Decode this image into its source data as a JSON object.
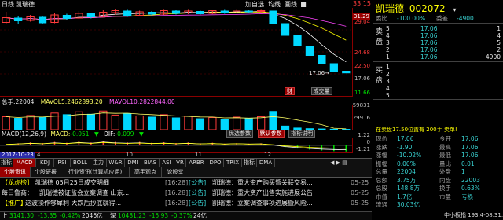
{
  "topbar": {
    "period": "日线",
    "name": "凯瑞德",
    "menu": [
      "加自选",
      "均线",
      "画线"
    ],
    "price_high": "33.15",
    "price_cur": "31.29"
  },
  "price_axis": [
    "29.04",
    "24.68",
    "22.50",
    "17.06",
    "11.66"
  ],
  "price_axis_colors": [
    "#ff3b3b",
    "#ff3b3b",
    "#ff3b3b",
    "#c0c0c0",
    "#00e000"
  ],
  "candles": [
    {
      "o": 29.9,
      "c": 31.1,
      "h": 32.6,
      "l": 29.4
    },
    {
      "o": 31.0,
      "c": 30.3,
      "h": 31.6,
      "l": 29.6
    },
    {
      "o": 30.4,
      "c": 31.3,
      "h": 31.8,
      "l": 30.1
    },
    {
      "o": 31.2,
      "c": 29.8,
      "h": 31.5,
      "l": 29.6
    },
    {
      "o": 29.9,
      "c": 31.8,
      "h": 32.4,
      "l": 29.7
    },
    {
      "o": 31.7,
      "c": 30.9,
      "h": 32.1,
      "l": 30.6
    },
    {
      "o": 31.0,
      "c": 32.2,
      "h": 32.8,
      "l": 30.8
    },
    {
      "o": 32.1,
      "c": 31.3,
      "h": 32.4,
      "l": 30.9
    },
    {
      "o": 31.4,
      "c": 32.5,
      "h": 33.0,
      "l": 31.2
    },
    {
      "o": 32.4,
      "c": 32.9,
      "h": 33.2,
      "l": 31.9
    },
    {
      "o": 32.8,
      "c": 31.6,
      "h": 33.1,
      "l": 31.3
    },
    {
      "o": 31.7,
      "c": 32.6,
      "h": 32.9,
      "l": 31.4
    },
    {
      "o": 32.5,
      "c": 32.0,
      "h": 32.8,
      "l": 31.6
    },
    {
      "o": 32.0,
      "c": 32.9,
      "h": 33.1,
      "l": 31.8
    },
    {
      "o": 32.8,
      "c": 32.2,
      "h": 33.0,
      "l": 31.9
    },
    {
      "o": 32.3,
      "c": 32.8,
      "h": 33.1,
      "l": 32.0
    },
    {
      "o": 32.7,
      "c": 32.1,
      "h": 32.9,
      "l": 31.9
    },
    {
      "o": 32.2,
      "c": 32.9,
      "h": 33.0,
      "l": 32.0
    },
    {
      "o": 32.8,
      "c": 32.4,
      "h": 33.1,
      "l": 32.1
    },
    {
      "o": 32.3,
      "c": 32.8,
      "h": 33.1,
      "l": 32.2
    },
    {
      "o": 32.8,
      "c": 32.6,
      "h": 33.0,
      "l": 32.3
    },
    {
      "o": 32.7,
      "c": 32.9,
      "h": 33.1,
      "l": 32.4
    },
    {
      "o": 32.8,
      "c": 29.6,
      "h": 32.9,
      "l": 29.4
    },
    {
      "o": 29.6,
      "c": 26.6,
      "h": 29.6,
      "l": 26.6
    },
    {
      "o": 26.6,
      "c": 23.9,
      "h": 26.6,
      "l": 23.9
    },
    {
      "o": 23.9,
      "c": 21.5,
      "h": 23.9,
      "l": 21.5
    },
    {
      "o": 21.5,
      "c": 19.4,
      "h": 21.5,
      "l": 19.4
    },
    {
      "o": 19.4,
      "c": 17.5,
      "h": 19.4,
      "l": 17.5
    },
    {
      "o": 17.5,
      "c": 17.06,
      "h": 17.5,
      "l": 17.06
    }
  ],
  "price_range": [
    11.2,
    33.6
  ],
  "price_labels": {
    "low_tag": "17.06",
    "low_sym": "→"
  },
  "kchart_buttons": {
    "xiao": "财",
    "big": "成交量"
  },
  "volume_legend": {
    "total_label": "总手:",
    "total": "22004",
    "mavol5_label": "MAVOL5:",
    "mavol5": "2462893.20",
    "mavol10_label": "MAVOL10:",
    "mavol10": "2822844.00"
  },
  "volume_axis": [
    "59831",
    "29916"
  ],
  "volume_bars": [
    {
      "v": 32000,
      "up": true
    },
    {
      "v": 28000,
      "up": false
    },
    {
      "v": 35000,
      "up": true
    },
    {
      "v": 30000,
      "up": false
    },
    {
      "v": 41000,
      "up": true
    },
    {
      "v": 37000,
      "up": false
    },
    {
      "v": 44000,
      "up": true
    },
    {
      "v": 38000,
      "up": false
    },
    {
      "v": 46000,
      "up": true
    },
    {
      "v": 36000,
      "up": true
    },
    {
      "v": 39000,
      "up": false
    },
    {
      "v": 34000,
      "up": true
    },
    {
      "v": 31000,
      "up": false
    },
    {
      "v": 37000,
      "up": true
    },
    {
      "v": 29000,
      "up": false
    },
    {
      "v": 33000,
      "up": true
    },
    {
      "v": 27000,
      "up": false
    },
    {
      "v": 30000,
      "up": true
    },
    {
      "v": 26000,
      "up": false
    },
    {
      "v": 31000,
      "up": true
    },
    {
      "v": 28000,
      "up": false
    },
    {
      "v": 32000,
      "up": true
    },
    {
      "v": 45000,
      "up": false
    },
    {
      "v": 9000,
      "up": false
    },
    {
      "v": 4000,
      "up": false
    },
    {
      "v": 2500,
      "up": false
    },
    {
      "v": 1800,
      "up": false
    },
    {
      "v": 1200,
      "up": false
    },
    {
      "v": 900,
      "up": false
    }
  ],
  "volume_max": 60000,
  "macd_legend": {
    "name": "MACD(12,26,9)",
    "macd_label": "MACD:",
    "macd": "-0.051",
    "dif_label": "DIF:",
    "dif": "-0.099"
  },
  "macd_axis": [
    "1.22",
    "0",
    "-1.21"
  ],
  "macd_buttons": [
    "优选参数",
    "默认参数",
    "指标说明"
  ],
  "macd_bars": [
    0.2,
    0.35,
    0.5,
    0.4,
    0.6,
    0.45,
    0.7,
    0.5,
    0.8,
    0.6,
    0.5,
    0.6,
    0.45,
    0.55,
    0.4,
    0.5,
    0.35,
    0.45,
    0.3,
    0.4,
    0.3,
    0.35,
    0.1,
    -0.3,
    -0.55,
    -0.75,
    -0.9,
    -1.0,
    -1.05
  ],
  "date_label": "2017-10-23",
  "date_extra": "4",
  "timeline_marks": [
    "10",
    "11",
    "12"
  ],
  "indicator_tabs": [
    "指标A",
    "MACD",
    "KDJ",
    "RSI",
    "BOLL",
    "主力",
    "W&R",
    "DMI",
    "BIAS",
    "ASI",
    "VR",
    "ARBR",
    "DPO",
    "TRIX",
    "指标B",
    "DMA"
  ],
  "indicator_active": 1,
  "news_tabs": [
    "个股资讯",
    "个股研报",
    "行业资讯(计算机应用)",
    "高手观点",
    "论股堂"
  ],
  "news_active": 0,
  "news_left": [
    {
      "tag": "【龙虎榜】",
      "text": "凯瑞德 05月25日成交明细",
      "src": "[16:28]"
    },
    {
      "tag": "每日鲁商：",
      "text": "凯瑞德被证监会立案调查 山东...",
      "src": "[16:28]"
    },
    {
      "tag": "【推广】",
      "text": "这波操作够犀利 大跌后抄底就得...",
      "src": "[16:28]"
    }
  ],
  "news_right": [
    {
      "tag": "[公告]",
      "text": "凯瑞德：重大资产购买暨关联交易...",
      "date": "05-25"
    },
    {
      "tag": "[公告]",
      "text": "凯瑞德：重大资产出售实施进展公告",
      "date": "05-25"
    },
    {
      "tag": "[公告]",
      "text": "凯瑞德：立案调查事项进展暨风险...",
      "date": "05-25"
    }
  ],
  "status": {
    "items": [
      {
        "label": "上",
        "value": "3141.30",
        "change": "-13.35",
        "pct": "-0.42%",
        "amt": "2046亿"
      },
      {
        "label": "深",
        "value": "10481.23",
        "change": "-15.93",
        "pct": "-0.37%",
        "amt": "24亿"
      }
    ]
  },
  "quote": {
    "name": "凯瑞德",
    "code": "002072",
    "ratio_label": "委比",
    "ratio": "-100.00%",
    "diff_label": "委差",
    "diff": "-4900",
    "sell_label": "卖盘",
    "buy_label": "买盘",
    "sell": [
      {
        "n": "5",
        "price": "17.06",
        "vol": "1"
      },
      {
        "n": "4",
        "price": "17.06",
        "vol": "4"
      },
      {
        "n": "3",
        "price": "17.06",
        "vol": "5"
      },
      {
        "n": "2",
        "price": "17.06",
        "vol": "2"
      },
      {
        "n": "1",
        "price": "17.06",
        "vol": "4900"
      }
    ],
    "buy": [
      {
        "n": "1",
        "price": "",
        "vol": ""
      },
      {
        "n": "2",
        "price": "",
        "vol": ""
      },
      {
        "n": "3",
        "price": "",
        "vol": ""
      },
      {
        "n": "4",
        "price": "",
        "vol": ""
      },
      {
        "n": "5",
        "price": "",
        "vol": ""
      }
    ],
    "summary_line": "在卖盘17.50位置有 200手  卖单!",
    "stats": [
      {
        "l": "现价",
        "v": "17.06",
        "l2": "今开",
        "v2": "17.06"
      },
      {
        "l": "涨跌",
        "v": "-1.90",
        "l2": "最高",
        "v2": "17.06"
      },
      {
        "l": "涨幅",
        "v": "-10.02%",
        "l2": "最低",
        "v2": "17.06"
      },
      {
        "l": "振幅",
        "v": "0.00%",
        "l2": "量比",
        "v2": "0.01"
      },
      {
        "l": "总量",
        "v": "22004",
        "l2": "外盘",
        "v2": "1"
      },
      {
        "l": "总额",
        "v": "3.75万",
        "l2": "内盘",
        "v2": "22003"
      },
      {
        "l": "总股",
        "v": "148.8万",
        "l2": "换手",
        "v2": "0.63%"
      },
      {
        "l": "市值",
        "v": "1.7亿",
        "l2": "市盈",
        "v2": "亏损"
      },
      {
        "l": "流通",
        "v": "30.03亿",
        "l2": "",
        "v2": ""
      }
    ],
    "bottom": "中小板指  193.4-08.31.21"
  },
  "colors": {
    "up": "#ff3b3b",
    "down": "#00d8ff",
    "bg": "#000000",
    "accent": "#9a0000"
  }
}
